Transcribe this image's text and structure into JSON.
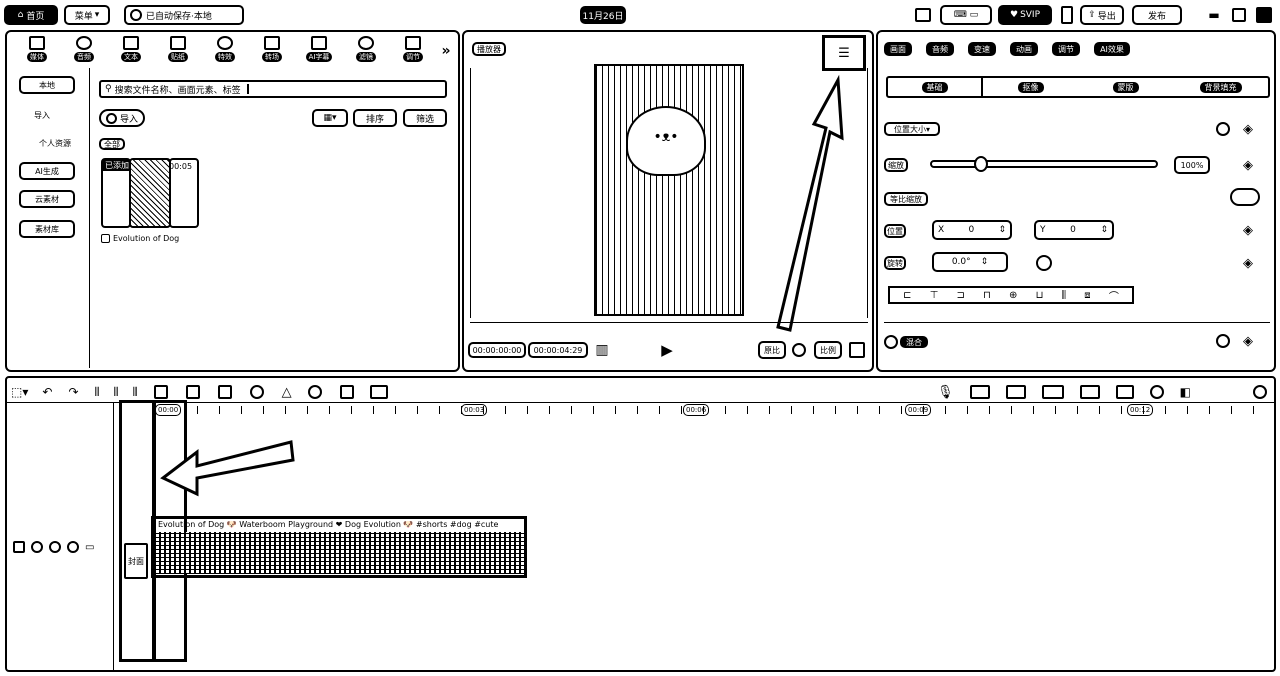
{
  "topbar": {
    "home_label": "首页",
    "menu_label": "菜单",
    "autosave_text": "已自动保存·本地",
    "project_title": "11月26日",
    "svip_label": "SVIP",
    "export_label": "导出",
    "publish_label": "发布"
  },
  "media_tabs": [
    {
      "label": "媒体",
      "icon": "media-icon"
    },
    {
      "label": "音频",
      "icon": "audio-icon"
    },
    {
      "label": "文本",
      "icon": "text-icon"
    },
    {
      "label": "贴纸",
      "icon": "sticker-icon"
    },
    {
      "label": "特效",
      "icon": "effects-icon"
    },
    {
      "label": "转场",
      "icon": "transition-icon"
    },
    {
      "label": "AI字幕",
      "icon": "ai-subtitle-icon"
    },
    {
      "label": "滤镜",
      "icon": "filter-icon"
    },
    {
      "label": "调节",
      "icon": "adjust-icon"
    }
  ],
  "media_side": {
    "items": [
      "本地",
      "导入",
      "个人资源",
      "AI生成",
      "云素材",
      "素材库"
    ]
  },
  "media_panel": {
    "search_placeholder": "搜索文件名称、画面元素、标签",
    "import_label": "导入",
    "view_label": "视图",
    "sort_label": "排序",
    "filter_label": "筛选",
    "all_tag": "全部",
    "clip_badge": "已添加",
    "clip_duration": "00:05",
    "clip_name": "Evolution of Dog"
  },
  "player": {
    "title": "播放器",
    "current_time": "00:00:00:00",
    "total_time": "00:00:04:29",
    "original_label": "原比",
    "ratio_label": "比例"
  },
  "inspector": {
    "tabs": [
      "画面",
      "音频",
      "变速",
      "动画",
      "调节",
      "AI效果"
    ],
    "subtabs": [
      "基础",
      "抠像",
      "蒙版",
      "背景填充"
    ],
    "section_position": "位置大小",
    "scale_label": "缩放",
    "scale_value": "100%",
    "uniform_scale": "等比缩放",
    "position_label": "位置",
    "pos_x": "0",
    "pos_y": "0",
    "rotate_label": "旋转",
    "rotate_value": "0.0°",
    "blend_label": "混合"
  },
  "timeline": {
    "ticks": [
      "00:00",
      "00:03",
      "00:06",
      "00:09",
      "00:12"
    ],
    "clip_title": "Evolution of Dog 🐶 Waterboom Playground ❤ Dog Evolution 🐶 #shorts #dog #cute",
    "cover_label": "封面"
  }
}
